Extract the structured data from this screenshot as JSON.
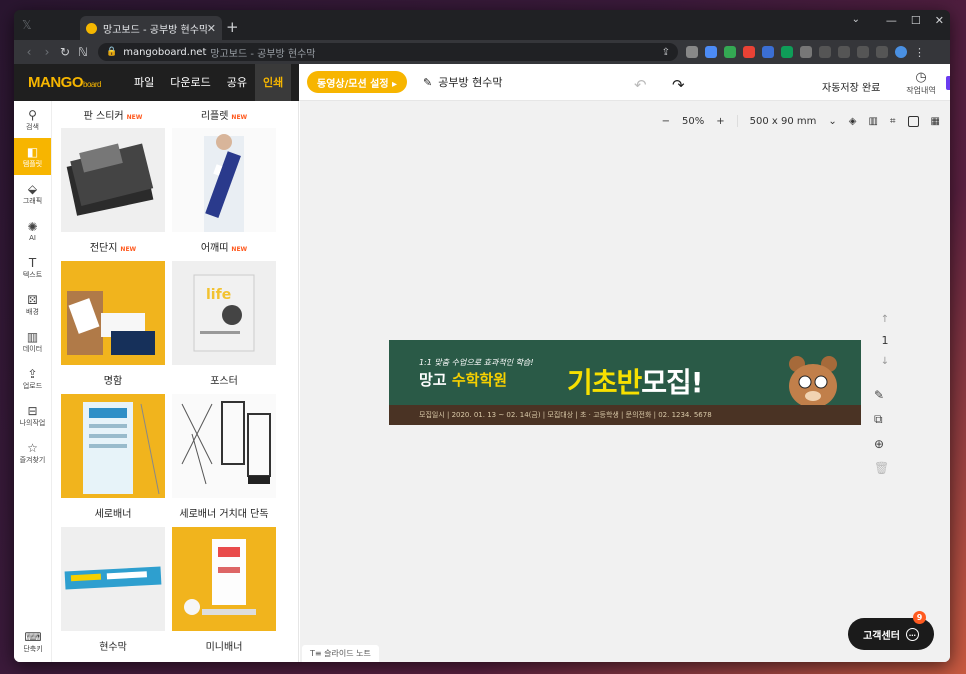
{
  "browser": {
    "tab_title": "망고보드 - 공부방 현수막",
    "url_host": "mangoboard.net",
    "url_title": "망고보드 - 공부방 현수막"
  },
  "header": {
    "logo_main": "MANGO",
    "logo_sub": "board",
    "menus": [
      "파일",
      "다운로드",
      "공유",
      "인쇄"
    ],
    "active_menu": "인쇄",
    "animation_button": "동영상/모션 설정 ▸",
    "doc_name": "공부방 현수막",
    "autosave": "자동저장 완료",
    "history": "작업내역"
  },
  "sidebar": {
    "items": [
      {
        "label": "검색",
        "icon": "search-icon"
      },
      {
        "label": "템플릿",
        "icon": "template-icon"
      },
      {
        "label": "그래픽",
        "icon": "graphic-icon"
      },
      {
        "label": "AI",
        "icon": "ai-icon"
      },
      {
        "label": "텍스트",
        "icon": "text-icon"
      },
      {
        "label": "배경",
        "icon": "background-icon"
      },
      {
        "label": "데이터",
        "icon": "chart-icon"
      },
      {
        "label": "업로드",
        "icon": "upload-icon"
      },
      {
        "label": "나의작업",
        "icon": "mywork-icon"
      },
      {
        "label": "즐겨찾기",
        "icon": "star-icon"
      }
    ],
    "shortcut": "단축키"
  },
  "panel": {
    "top_labels": [
      {
        "label": "판 스티커",
        "new": "NEW"
      },
      {
        "label": "리플렛",
        "new": "NEW"
      }
    ],
    "templates": [
      {
        "label": "전단지",
        "new": "NEW"
      },
      {
        "label": "어깨띠",
        "new": "NEW"
      },
      {
        "label": "명함",
        "new": ""
      },
      {
        "label": "포스터",
        "new": ""
      },
      {
        "label": "세로배너",
        "new": ""
      },
      {
        "label": "세로배너 거치대 단독",
        "new": ""
      },
      {
        "label": "현수막",
        "new": ""
      },
      {
        "label": "미니배너",
        "new": ""
      }
    ]
  },
  "canvas": {
    "zoom": "50%",
    "size": "500 x 90 mm",
    "page_number": "1",
    "slide_note": "슬라이드 노트",
    "banner": {
      "subtitle": "1:1 맞춤 수업으로 효과적인 학습!",
      "title_prefix": "망고 ",
      "title_highlight": "수학학원",
      "big_yellow": "기초반",
      "big_white": "모집!",
      "info": "모집일시 | 2020. 01. 13 ~ 02. 14(금) | 모집대상 | 초 · 고등학생 | 문의전화 | 02. 1234. 5678"
    }
  },
  "support": {
    "label": "고객센터",
    "badge": "9"
  }
}
